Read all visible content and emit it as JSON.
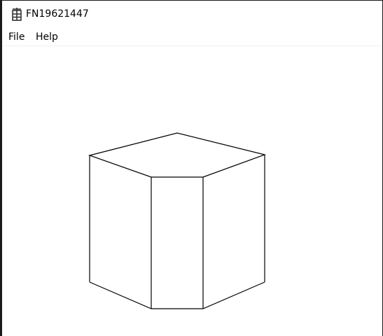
{
  "window": {
    "title": "FN19621447",
    "icon": "app-icon"
  },
  "menubar": {
    "items": [
      {
        "label": "File"
      },
      {
        "label": "Help"
      }
    ]
  },
  "canvas": {
    "shape": "hexagonal-prism",
    "stroke_color": "#000000",
    "background_color": "#ffffff"
  }
}
